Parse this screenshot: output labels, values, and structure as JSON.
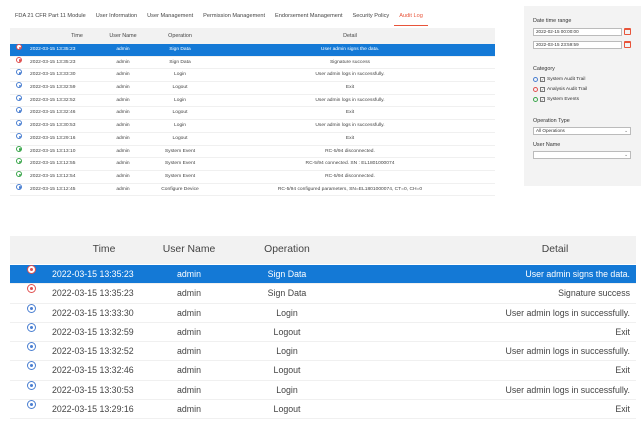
{
  "tabs": [
    {
      "label": "FDA 21 CFR Part 11 Module",
      "active": false
    },
    {
      "label": "User Information",
      "active": false
    },
    {
      "label": "User Management",
      "active": false
    },
    {
      "label": "Permission Management",
      "active": false
    },
    {
      "label": "Endorsement Management",
      "active": false
    },
    {
      "label": "Security Policy",
      "active": false
    },
    {
      "label": "Audit Log",
      "active": true
    }
  ],
  "columns": {
    "time": "Time",
    "user": "User Name",
    "operation": "Operation",
    "detail": "Detail"
  },
  "rows": [
    {
      "status": "red",
      "time": "2022-03-15 13:35:23",
      "user": "admin",
      "operation": "Sign Data",
      "detail": "User admin signs the data.",
      "selected": true
    },
    {
      "status": "red",
      "time": "2022-03-15 13:35:23",
      "user": "admin",
      "operation": "Sign Data",
      "detail": "Signature success"
    },
    {
      "status": "blue",
      "time": "2022-03-15 13:33:30",
      "user": "admin",
      "operation": "Login",
      "detail": "User admin logs in successfully."
    },
    {
      "status": "blue",
      "time": "2022-03-15 13:32:59",
      "user": "admin",
      "operation": "Logout",
      "detail": "Exit"
    },
    {
      "status": "blue",
      "time": "2022-03-15 13:32:52",
      "user": "admin",
      "operation": "Login",
      "detail": "User admin logs in successfully."
    },
    {
      "status": "blue",
      "time": "2022-03-15 13:32:46",
      "user": "admin",
      "operation": "Logout",
      "detail": "Exit"
    },
    {
      "status": "blue",
      "time": "2022-03-15 13:30:53",
      "user": "admin",
      "operation": "Login",
      "detail": "User admin logs in successfully."
    },
    {
      "status": "blue",
      "time": "2022-03-15 13:29:16",
      "user": "admin",
      "operation": "Logout",
      "detail": "Exit"
    },
    {
      "status": "green",
      "time": "2022-03-15 13:13:10",
      "user": "admin",
      "operation": "System Event",
      "detail": "RC-5/94 disconnected."
    },
    {
      "status": "green",
      "time": "2022-03-15 13:12:55",
      "user": "admin",
      "operation": "System Event",
      "detail": "RC-5/94 connected. SN : EL1801000074"
    },
    {
      "status": "green",
      "time": "2022-03-15 13:12:54",
      "user": "admin",
      "operation": "System Event",
      "detail": "RC-5/94 disconnected."
    },
    {
      "status": "blue",
      "time": "2022-03-15 13:12:45",
      "user": "admin",
      "operation": "Configure Device",
      "detail": "RC-5/94 configured parameters, SN=EL1801000074, CT=0, CH=0"
    }
  ],
  "sidebar": {
    "date_range_label": "Date time range",
    "start_date": "2022-02-15 00:00:00",
    "end_date": "2022-03-15 23:59:59",
    "category_label": "Category",
    "categories": [
      {
        "label": "System Audit Trail",
        "color": "blue"
      },
      {
        "label": "Analysis Audit Trail",
        "color": "red"
      },
      {
        "label": "System Events",
        "color": "green"
      }
    ],
    "operation_type_label": "Operation Type",
    "operation_type_value": "All Operations",
    "user_name_label": "User Name",
    "user_name_value": ""
  },
  "zoom_rows_count_note": "",
  "colors": {
    "accent": "#e8543a",
    "selection": "#1479d6"
  }
}
